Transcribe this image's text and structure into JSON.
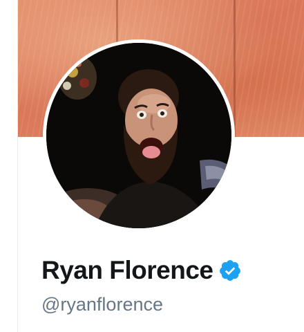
{
  "profile": {
    "display_name": "Ryan Florence",
    "handle": "@ryanflorence",
    "verified": true
  },
  "icons": {
    "verified_badge": "verified-badge-icon"
  },
  "colors": {
    "name_text": "#14171a",
    "handle_text": "#657786",
    "verified_blue": "#1da1f2",
    "banner": "#de8260",
    "avatar_ring": "#ffffff"
  }
}
